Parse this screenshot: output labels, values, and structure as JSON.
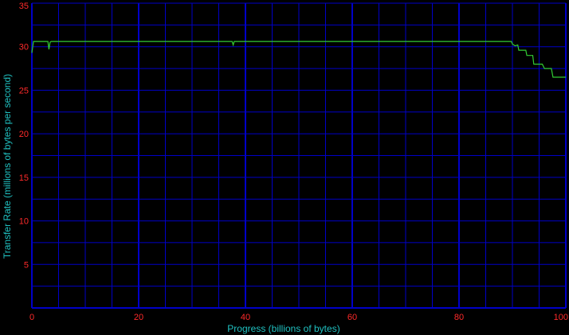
{
  "chart_data": {
    "type": "line",
    "xlabel": "Progress (billions of bytes)",
    "ylabel": "Transfer Rate (millions of bytes per second)",
    "xlim": [
      0,
      100
    ],
    "ylim": [
      0,
      35
    ],
    "x_ticks": [
      0,
      20,
      40,
      60,
      80,
      100
    ],
    "x_tick_labels": [
      "0",
      "20",
      "40",
      "60",
      "80",
      "100"
    ],
    "y_ticks": [
      5,
      10,
      15,
      20,
      25,
      30,
      35
    ],
    "y_tick_labels": [
      "5",
      "10",
      "15",
      "20",
      "25",
      "30",
      "35"
    ],
    "x_minor_step": 5,
    "y_minor_step": 2.5,
    "grid": true,
    "colors": {
      "background": "#000000",
      "grid": "#0000c8",
      "line": "#32cd32",
      "tick_label": "#ff2a2a",
      "axis_label": "#20c0c0"
    },
    "series": [
      {
        "x": [
          0,
          0.3,
          3.0,
          3.2,
          3.4,
          3.6,
          5,
          10,
          15,
          20,
          25,
          30,
          37.5,
          37.7,
          37.9,
          40,
          45,
          50,
          55,
          60,
          65,
          70,
          75,
          80,
          85,
          89.6,
          89.8,
          90.0,
          90.5,
          91.0,
          91.2,
          92.5,
          92.7,
          93.8,
          94.0,
          95.6,
          96.0,
          97.3,
          97.6,
          98.5,
          100
        ],
        "y": [
          29.3,
          30.6,
          30.6,
          29.7,
          30.5,
          30.6,
          30.6,
          30.6,
          30.6,
          30.6,
          30.6,
          30.6,
          30.6,
          30.2,
          30.6,
          30.6,
          30.6,
          30.6,
          30.6,
          30.6,
          30.6,
          30.6,
          30.6,
          30.6,
          30.6,
          30.6,
          30.6,
          30.3,
          30.1,
          30.2,
          29.6,
          29.6,
          29.0,
          29.0,
          28.0,
          28.0,
          27.5,
          27.5,
          26.5,
          26.5,
          26.5
        ]
      }
    ]
  }
}
